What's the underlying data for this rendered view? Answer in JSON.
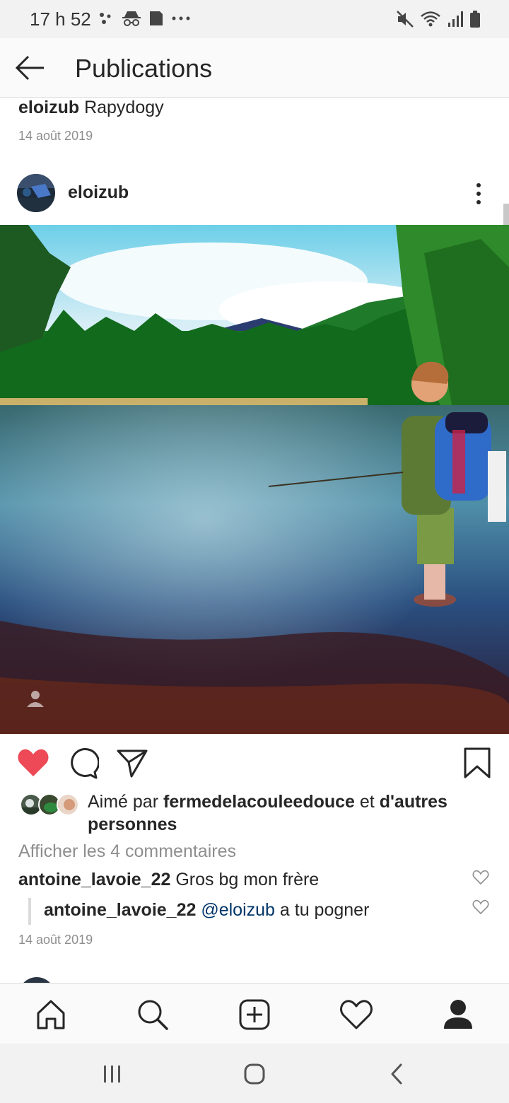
{
  "status_bar": {
    "time": "17 h 52",
    "left_icons": [
      "assistant-dots-icon",
      "incognito-icon",
      "sim-card-icon",
      "more-dots-icon"
    ],
    "right_icons": [
      "mute-icon",
      "wifi-icon",
      "signal-icon",
      "battery-icon"
    ]
  },
  "header": {
    "back_icon": "arrow-left-icon",
    "title": "Publications"
  },
  "previous_post": {
    "username": "eloizub",
    "caption": "Rapydogy",
    "date": "14 août 2019"
  },
  "post": {
    "username": "eloizub",
    "more_icon": "vertical-dots-icon",
    "photo_description_icon": "user-tag-icon",
    "liked": true,
    "like_color": "#ed4956",
    "likes": {
      "prefix": "Aimé par",
      "user": "fermedelacouleedouce",
      "connector": "et",
      "others": "d'autres personnes"
    },
    "view_comments": "Afficher les 4 commentaires",
    "comments": [
      {
        "user": "antoine_lavoie_22",
        "text": "Gros bg mon frère"
      },
      {
        "user": "antoine_lavoie_22",
        "mention": "@eloizub",
        "text": "a tu pogner"
      }
    ],
    "date": "14 août 2019"
  },
  "bottom_nav": [
    "home-icon",
    "search-icon",
    "new-post-icon",
    "activity-heart-icon",
    "profile-icon"
  ],
  "system_nav": [
    "recent-apps-icon",
    "home-button-icon",
    "back-button-icon"
  ]
}
